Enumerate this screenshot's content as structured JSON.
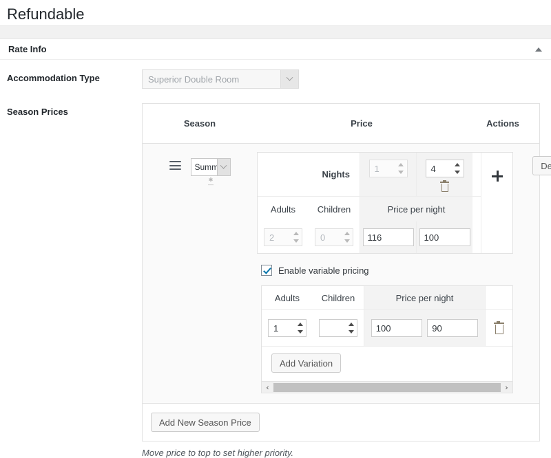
{
  "page": {
    "title": "Refundable"
  },
  "metabox": {
    "title": "Rate Info",
    "toggle_icon": "caret-up-icon"
  },
  "accommodation": {
    "label": "Accommodation Type",
    "value": "Superior Double Room",
    "disabled": true,
    "dropdown_icon": "chevron-down-icon"
  },
  "season_prices": {
    "label": "Season Prices",
    "columns": {
      "season": "Season",
      "price": "Price",
      "actions": "Actions"
    },
    "row": {
      "drag_icon": "drag-handle-icon",
      "season_value": "Summ",
      "delete_label": "Delete",
      "add_icon": "plus-icon",
      "price_block": {
        "nights_label": "Nights",
        "nights": [
          "1",
          "4"
        ],
        "nights_delete_icon": "trash-icon",
        "sub_headers": {
          "adults": "Adults",
          "children": "Children",
          "price_per_night": "Price per night"
        },
        "adults": "2",
        "children": "0",
        "prices": [
          "116",
          "100"
        ]
      },
      "variable_pricing": {
        "checkbox_label": "Enable variable pricing",
        "checked": true,
        "headers": {
          "adults": "Adults",
          "children": "Children",
          "price_per_night": "Price per night"
        },
        "variation": {
          "adults": "1",
          "children": "",
          "prices": [
            "100",
            "90"
          ],
          "delete_icon": "trash-icon"
        },
        "add_variation_label": "Add Variation",
        "scrollbar": {
          "left_icon": "chevron-left-icon",
          "right_icon": "chevron-right-icon"
        }
      }
    },
    "add_new_label": "Add New Season Price",
    "note": "Move price to top to set higher priority."
  },
  "colors": {
    "accent": "#0073aa",
    "panel_border": "#e2e2e2",
    "row_bg": "#fafafa",
    "cell_bg": "#f3f3f3",
    "trash": "#8a7f6b"
  }
}
